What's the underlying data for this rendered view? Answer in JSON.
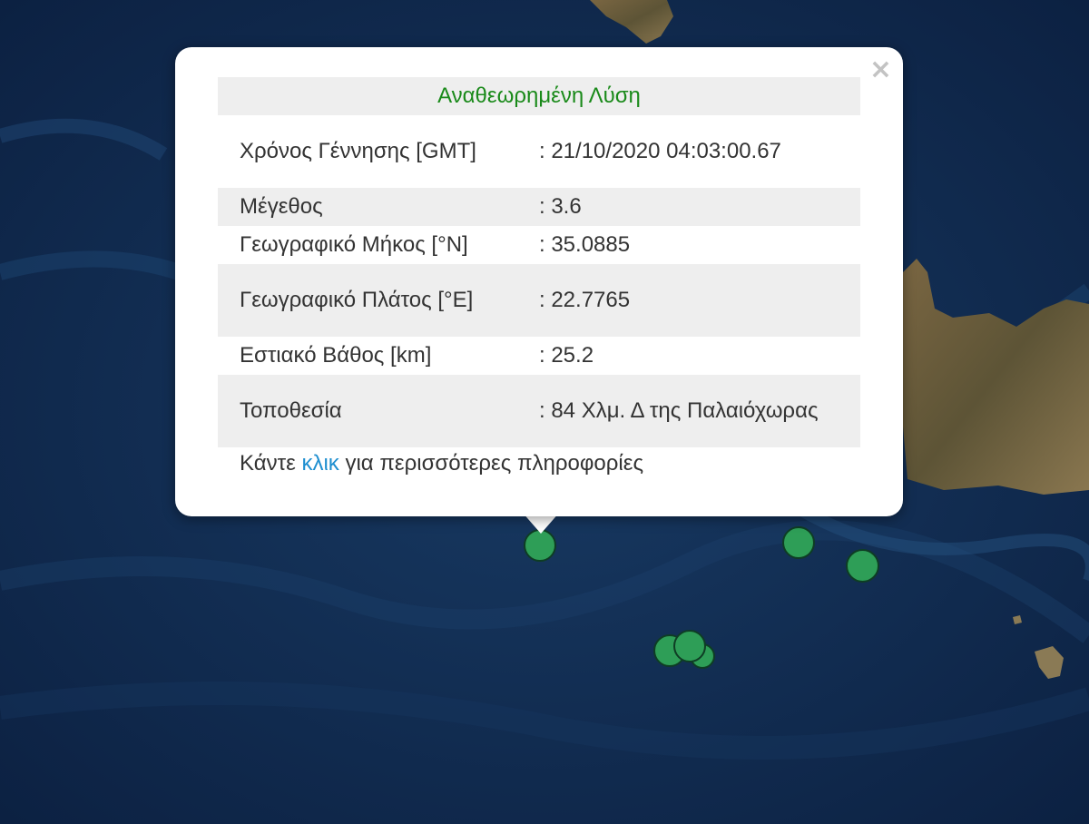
{
  "map": {
    "colors": {
      "sea": "#0f2747",
      "land": "#6e5a3c",
      "marker": "#2e9e57"
    }
  },
  "markers": [
    {
      "id": "quake-selected"
    },
    {
      "id": "quake-2"
    },
    {
      "id": "quake-3"
    },
    {
      "id": "quake-4"
    },
    {
      "id": "quake-5"
    },
    {
      "id": "quake-6"
    }
  ],
  "popup": {
    "close_symbol": "×",
    "title": "Αναθεωρημένη Λύση",
    "rows": [
      {
        "label": "Χρόνος Γέννησης [GMT]",
        "value": ": 21/10/2020 04:03:00.67"
      },
      {
        "label": "Μέγεθος",
        "value": ": 3.6"
      },
      {
        "label": "Γεωγραφικό Μήκος [°N]",
        "value": ": 35.0885"
      },
      {
        "label": "Γεωγραφικό Πλάτος [°E]",
        "value": ": 22.7765"
      },
      {
        "label": "Εστιακό Βάθος [km]",
        "value": ": 25.2"
      },
      {
        "label": "Τοποθεσία",
        "value": ": 84 Χλμ. Δ της Παλαιόχωρας"
      }
    ],
    "footer": {
      "prefix": "Κάντε ",
      "link_text": "κλικ",
      "suffix": " για περισσότερες πληροφορίες"
    },
    "colors": {
      "title": "#1a8a1a",
      "link": "#1f8fd0",
      "row_shade": "#eeeeee"
    }
  }
}
